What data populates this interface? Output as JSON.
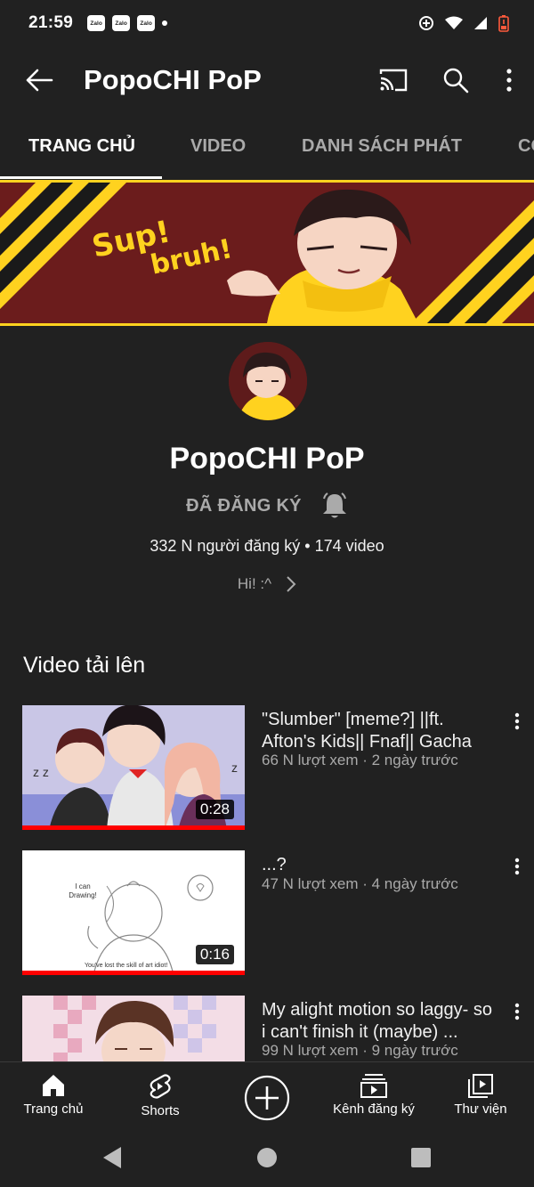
{
  "status_bar": {
    "time": "21:59",
    "notification_icons": [
      "Zalo",
      "Zalo",
      "Zalo"
    ]
  },
  "app_bar": {
    "title": "PopoCHI PoP"
  },
  "tabs": [
    {
      "label": "TRANG CHỦ",
      "active": true
    },
    {
      "label": "VIDEO",
      "active": false
    },
    {
      "label": "DANH SÁCH PHÁT",
      "active": false
    },
    {
      "label": "CỘ",
      "active": false
    }
  ],
  "banner": {
    "text_line1": "Sup!",
    "text_line2": "bruh!"
  },
  "channel": {
    "name": "PopoCHI PoP",
    "subscribe_state": "ĐÃ ĐĂNG KÝ",
    "subscribers": "332 N người đăng ký",
    "separator": "•",
    "video_count": "174 video",
    "about_snippet": "Hi! :^"
  },
  "section": {
    "title": "Video tải lên"
  },
  "videos": [
    {
      "title": "\"Slumber\" [meme?] ||ft. Afton's Kids|| Fnaf|| Gacha",
      "meta": "66 N lượt xem · 2 ngày trước",
      "duration": "0:28",
      "watched": 1.0
    },
    {
      "title": "...?",
      "meta": "47 N lượt xem · 4 ngày trước",
      "duration": "0:16",
      "watched": 1.0,
      "thumb_text1": "I can Drawing!",
      "thumb_text2": "You've lost the skill of art idiot!"
    },
    {
      "title": "My alight motion so laggy- so i can't finish it (maybe) ...",
      "meta": "99 N lượt xem · 9 ngày trước",
      "duration": "",
      "watched": 0
    }
  ],
  "bottom_nav": [
    {
      "label": "Trang chủ",
      "icon": "home-icon"
    },
    {
      "label": "Shorts",
      "icon": "shorts-icon"
    },
    {
      "label": "",
      "icon": "create-icon"
    },
    {
      "label": "Kênh đăng ký",
      "icon": "subscriptions-icon"
    },
    {
      "label": "Thư viện",
      "icon": "library-icon"
    }
  ],
  "colors": {
    "background": "#212121",
    "progress": "#ff0000",
    "banner_red": "#6b1c1c",
    "banner_yellow": "#ffd21f"
  }
}
